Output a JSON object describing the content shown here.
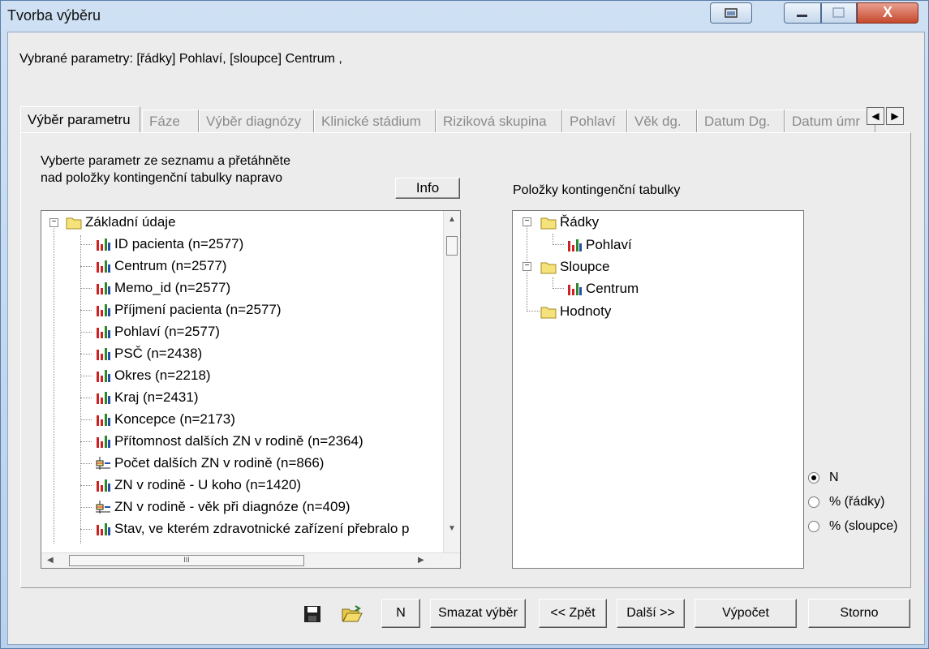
{
  "window": {
    "title": "Tvorba výběru"
  },
  "selected_params": "Vybrané parametry: [řádky] Pohlaví, [sloupce] Centrum  ,",
  "tabs": [
    {
      "label": "Výběr parametru",
      "active": true
    },
    {
      "label": "Fáze"
    },
    {
      "label": "Výběr diagnózy"
    },
    {
      "label": "Klinické stádium"
    },
    {
      "label": "Riziková skupina"
    },
    {
      "label": "Pohlaví"
    },
    {
      "label": "Věk dg."
    },
    {
      "label": "Datum Dg."
    },
    {
      "label": "Datum úmr"
    }
  ],
  "instructions": {
    "line1": "Vyberte parametr ze seznamu a přetáhněte",
    "line2": "nad položky kontingenční tabulky napravo"
  },
  "info_button": "Info",
  "left_tree": {
    "root": "Základní údaje",
    "items": [
      {
        "label": "ID pacienta (n=2577)",
        "icon": "bar-chart-icon"
      },
      {
        "label": "Centrum (n=2577)",
        "icon": "bar-chart-icon"
      },
      {
        "label": "Memo_id (n=2577)",
        "icon": "bar-chart-icon"
      },
      {
        "label": "Příjmení pacienta (n=2577)",
        "icon": "bar-chart-icon"
      },
      {
        "label": "Pohlaví (n=2577)",
        "icon": "bar-chart-icon"
      },
      {
        "label": "PSČ (n=2438)",
        "icon": "bar-chart-icon"
      },
      {
        "label": "Okres (n=2218)",
        "icon": "bar-chart-icon"
      },
      {
        "label": "Kraj (n=2431)",
        "icon": "bar-chart-icon"
      },
      {
        "label": "Koncepce (n=2173)",
        "icon": "bar-chart-icon"
      },
      {
        "label": "Přítomnost dalších ZN v rodině (n=2364)",
        "icon": "bar-chart-icon"
      },
      {
        "label": "Počet dalších ZN v rodině (n=866)",
        "icon": "boxplot-icon"
      },
      {
        "label": "ZN v rodině - U koho (n=1420)",
        "icon": "bar-chart-icon"
      },
      {
        "label": "ZN v rodině - věk při diagnóze (n=409)",
        "icon": "boxplot-icon"
      },
      {
        "label": "Stav, ve kterém zdravotnické zařízení přebralo p",
        "icon": "bar-chart-icon"
      }
    ]
  },
  "right_label": "Položky kontingenční tabulky",
  "right_tree": {
    "rows": "Řádky",
    "rows_child": "Pohlaví",
    "cols": "Sloupce",
    "cols_child": "Centrum",
    "values": "Hodnoty"
  },
  "radios": [
    {
      "label": "N",
      "checked": true
    },
    {
      "label": "% (řádky)",
      "checked": false
    },
    {
      "label": "% (sloupce)",
      "checked": false
    }
  ],
  "buttons": {
    "n": "N",
    "clear": "Smazat výběr",
    "back": "<< Zpět",
    "next": "Další >>",
    "compute": "Výpočet",
    "cancel": "Storno"
  },
  "scroll_thumb_glyph": "III",
  "close_glyph": "X"
}
